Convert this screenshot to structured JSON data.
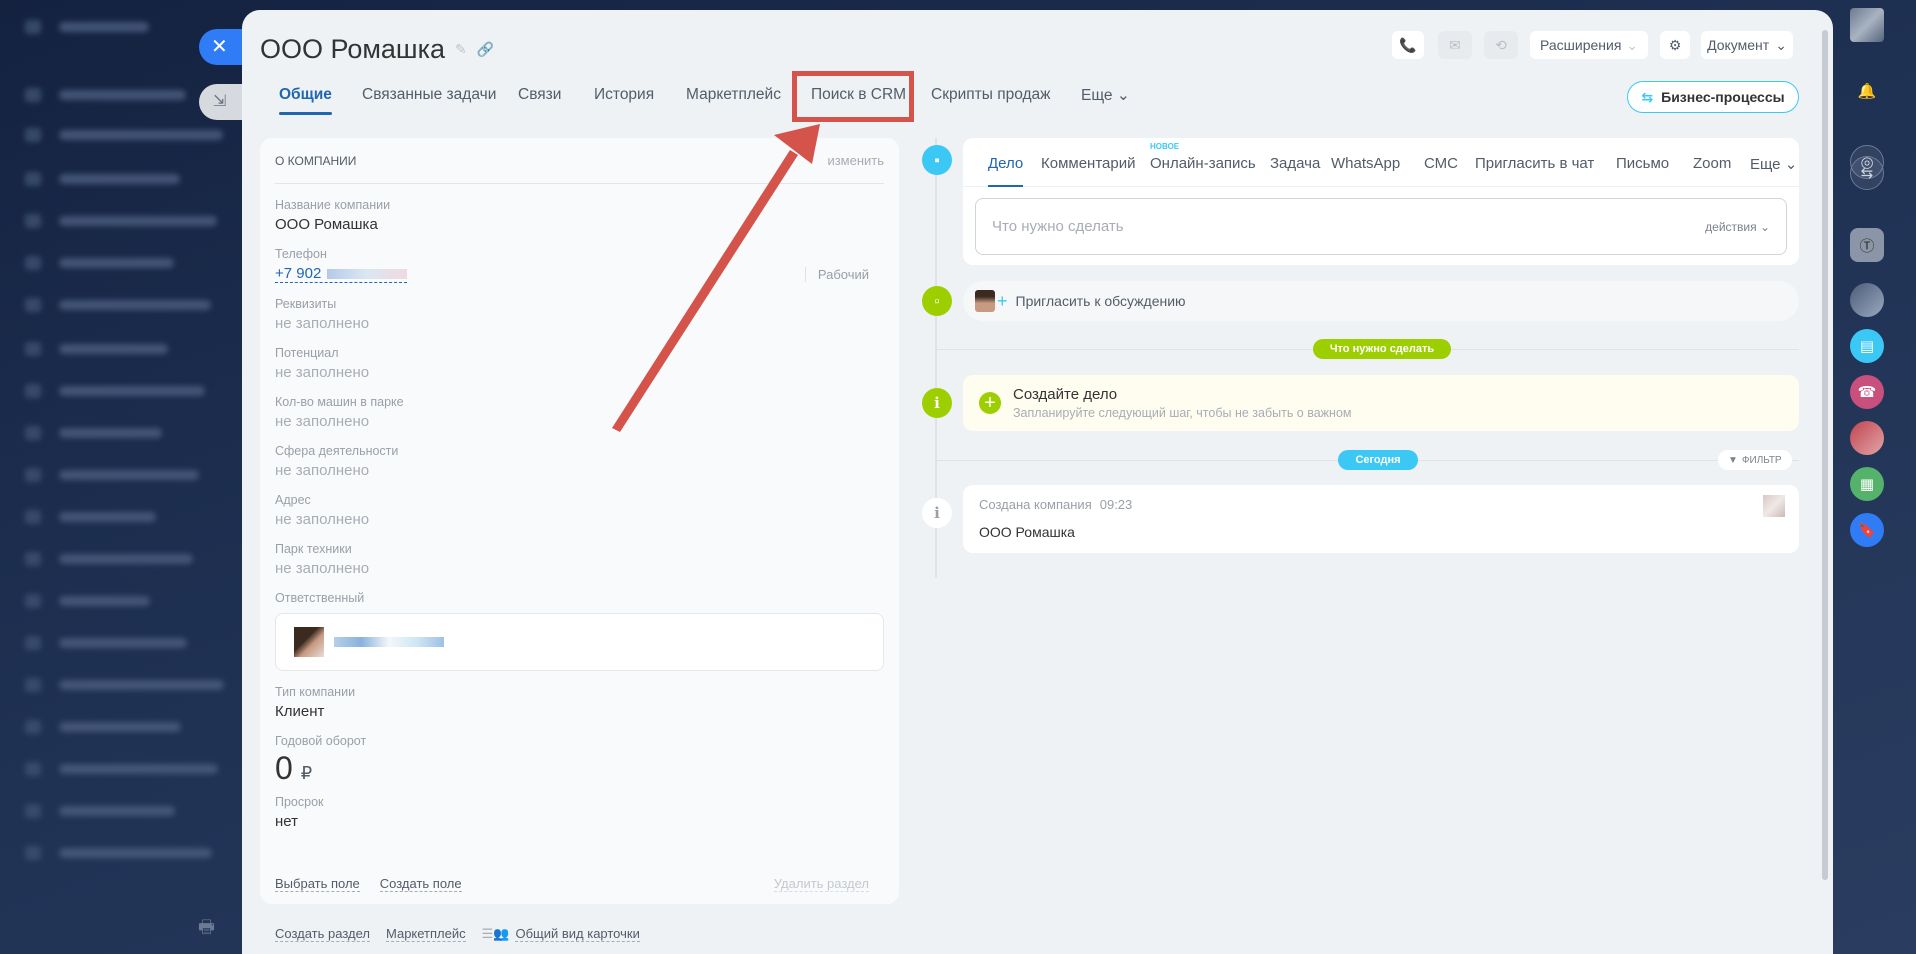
{
  "page": {
    "title": "ООО Ромашка"
  },
  "tabs": [
    {
      "label": "Общие",
      "active": true
    },
    {
      "label": "Связанные задачи"
    },
    {
      "label": "Связи"
    },
    {
      "label": "История"
    },
    {
      "label": "Маркетплейс"
    },
    {
      "label": "Поиск в CRM",
      "highlighted": true
    },
    {
      "label": "Скрипты продаж"
    },
    {
      "label": "Еще"
    }
  ],
  "toolbar": {
    "extensions": "Расширения",
    "document": "Документ",
    "business_processes": "Бизнес-процессы"
  },
  "about": {
    "header": "О компании",
    "edit": "изменить",
    "fields": [
      {
        "label": "Название компании",
        "value": "ООО Ромашка"
      },
      {
        "label": "Телефон",
        "value": "+7 902",
        "type": "Рабочий"
      },
      {
        "label": "Реквизиты",
        "value": "не заполнено"
      },
      {
        "label": "Потенциал",
        "value": "не заполнено"
      },
      {
        "label": "Кол-во машин в парке",
        "value": "не заполнено"
      },
      {
        "label": "Сфера деятельности",
        "value": "не заполнено"
      },
      {
        "label": "Адрес",
        "value": "не заполнено"
      },
      {
        "label": "Парк техники",
        "value": "не заполнено"
      },
      {
        "label": "Ответственный"
      },
      {
        "label": "Тип компании",
        "value": "Клиент"
      },
      {
        "label": "Годовой оборот",
        "value": "0",
        "currency": "₽"
      },
      {
        "label": "Просрок",
        "value": "нет"
      }
    ],
    "footer": {
      "select_field": "Выбрать поле",
      "create_field": "Создать поле",
      "delete_section": "Удалить раздел"
    }
  },
  "bottom_links": {
    "create_section": "Создать раздел",
    "marketplace": "Маркетплейс",
    "common_view": "Общий вид карточки"
  },
  "activity": {
    "tabs": [
      "Дело",
      "Комментарий",
      "Онлайн-запись",
      "Задача",
      "WhatsApp",
      "СМС",
      "Пригласить в чат",
      "Письмо",
      "Zoom",
      "Еще"
    ],
    "new_badge": "НОВОЕ",
    "placeholder": "Что нужно сделать",
    "actions": "действия"
  },
  "timeline": {
    "invite": "Пригласить к обсуждению",
    "todo_pill": "Что нужно сделать",
    "create_title": "Создайте дело",
    "create_sub": "Запланируйте следующий шаг, чтобы не забыть о важном",
    "today_pill": "Сегодня",
    "filter": "ФИЛЬТР",
    "event_title": "Создана компания",
    "event_time": "09:23",
    "event_body": "ООО Ромашка"
  },
  "colors": {
    "accent": "#2066b0",
    "green": "#9dcf00",
    "cyan": "#3bc8f5",
    "highlight": "#d4534a"
  }
}
